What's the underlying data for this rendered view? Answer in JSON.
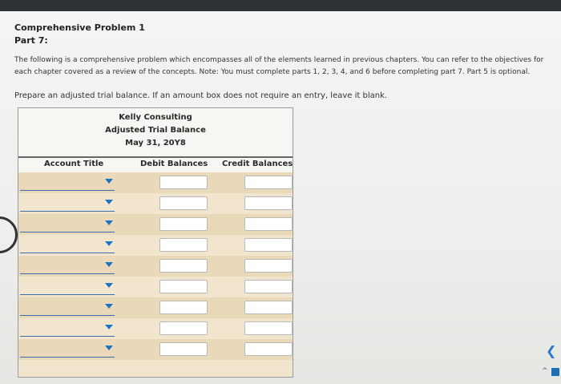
{
  "problem_title": "Comprehensive Problem 1",
  "part_label": "Part 7:",
  "intro_line1": "The following is a comprehensive problem which encompasses all of the elements learned in previous chapters. You can refer to the objectives for",
  "intro_line2": "each chapter covered as a review of the concepts. Note: You must complete parts 1, 2, 3, 4, and 6 before completing part 7. Part 5 is optional.",
  "instruction": "Prepare an adjusted trial balance. If an amount box does not require an entry, leave it blank.",
  "trial_balance": {
    "company": "Kelly Consulting",
    "statement": "Adjusted Trial Balance",
    "date": "May 31, 20Y8",
    "col_account": "Account Title",
    "col_debit": "Debit Balances",
    "col_credit": "Credit Balances",
    "rows": [
      {
        "account": "",
        "debit": "",
        "credit": ""
      },
      {
        "account": "",
        "debit": "",
        "credit": ""
      },
      {
        "account": "",
        "debit": "",
        "credit": ""
      },
      {
        "account": "",
        "debit": "",
        "credit": ""
      },
      {
        "account": "",
        "debit": "",
        "credit": ""
      },
      {
        "account": "",
        "debit": "",
        "credit": ""
      },
      {
        "account": "",
        "debit": "",
        "credit": ""
      },
      {
        "account": "",
        "debit": "",
        "credit": ""
      },
      {
        "account": "",
        "debit": "",
        "credit": ""
      }
    ]
  },
  "icons": {
    "dropdown": "chevron-down-icon",
    "nav_next": "chevron-left-icon"
  },
  "accent_color": "#1f73c9"
}
